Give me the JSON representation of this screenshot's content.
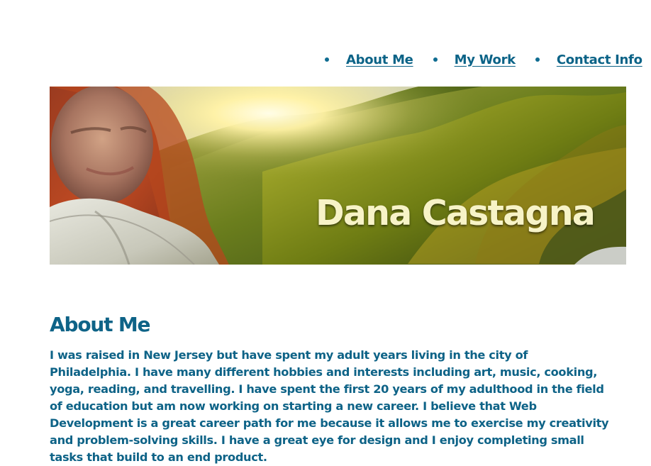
{
  "nav": {
    "items": [
      {
        "label": "About Me"
      },
      {
        "label": "My Work"
      },
      {
        "label": "Contact Info"
      }
    ]
  },
  "banner": {
    "name": "Dana Castagna"
  },
  "about": {
    "heading": "About Me",
    "body": "I was raised in New Jersey but have spent my adult years living in the city of Philadelphia. I have many different hobbies and interests including art, music, cooking, yoga, reading, and travelling. I have spent the first 20 years of my adulthood in the field of education but am now working on starting a new career. I believe that Web Development is a great career path for me because it allows me to exercise my creativity and problem-solving skills. I have a great eye for design and I enjoy completing small tasks that build to an end product."
  },
  "colors": {
    "text": "#0e6387",
    "banner_name": "#f7f3c7",
    "background": "#ffffff"
  }
}
